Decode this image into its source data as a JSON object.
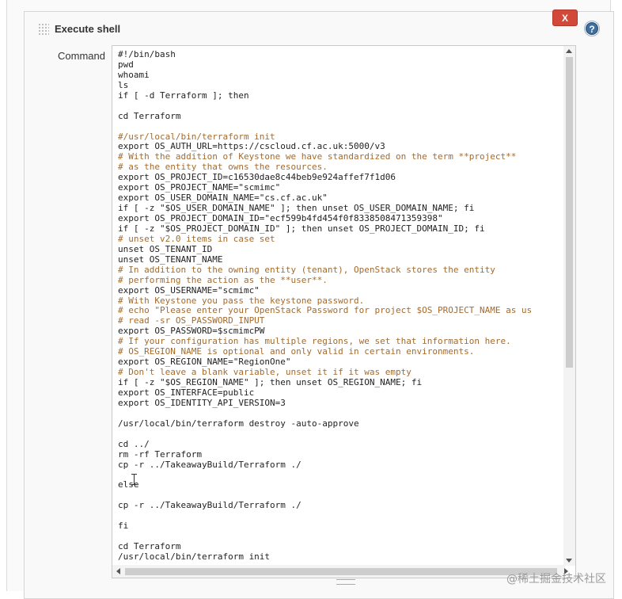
{
  "section": {
    "title": "Execute shell",
    "delete_label": "X",
    "help_label": "?"
  },
  "command": {
    "label": "Command",
    "lines": [
      {
        "text": "#!/bin/bash",
        "comment": false
      },
      {
        "text": "pwd",
        "comment": false
      },
      {
        "text": "whoami",
        "comment": false
      },
      {
        "text": "ls",
        "comment": false
      },
      {
        "text": "if [ -d Terraform ]; then",
        "comment": false
      },
      {
        "text": "",
        "comment": false
      },
      {
        "text": "cd Terraform",
        "comment": false
      },
      {
        "text": "",
        "comment": false
      },
      {
        "text": "#/usr/local/bin/terraform init",
        "comment": true
      },
      {
        "text": "export OS_AUTH_URL=https://cscloud.cf.ac.uk:5000/v3",
        "comment": false
      },
      {
        "text": "# With the addition of Keystone we have standardized on the term **project**",
        "comment": true
      },
      {
        "text": "# as the entity that owns the resources.",
        "comment": true
      },
      {
        "text": "export OS_PROJECT_ID=c16530dae8c44beb9e924affef7f1d06",
        "comment": false
      },
      {
        "text": "export OS_PROJECT_NAME=\"scmimc\"",
        "comment": false
      },
      {
        "text": "export OS_USER_DOMAIN_NAME=\"cs.cf.ac.uk\"",
        "comment": false
      },
      {
        "text": "if [ -z \"$OS_USER_DOMAIN_NAME\" ]; then unset OS_USER_DOMAIN_NAME; fi",
        "comment": false
      },
      {
        "text": "export OS_PROJECT_DOMAIN_ID=\"ecf599b4fd454f0f8338508471359398\"",
        "comment": false
      },
      {
        "text": "if [ -z \"$OS_PROJECT_DOMAIN_ID\" ]; then unset OS_PROJECT_DOMAIN_ID; fi",
        "comment": false
      },
      {
        "text": "# unset v2.0 items in case set",
        "comment": true
      },
      {
        "text": "unset OS_TENANT_ID",
        "comment": false
      },
      {
        "text": "unset OS_TENANT_NAME",
        "comment": false
      },
      {
        "text": "# In addition to the owning entity (tenant), OpenStack stores the entity",
        "comment": true
      },
      {
        "text": "# performing the action as the **user**.",
        "comment": true
      },
      {
        "text": "export OS_USERNAME=\"scmimc\"",
        "comment": false
      },
      {
        "text": "# With Keystone you pass the keystone password.",
        "comment": true
      },
      {
        "text": "# echo \"Please enter your OpenStack Password for project $OS_PROJECT_NAME as us",
        "comment": true
      },
      {
        "text": "# read -sr OS_PASSWORD_INPUT",
        "comment": true
      },
      {
        "text": "export OS_PASSWORD=$scmimcPW",
        "comment": false
      },
      {
        "text": "# If your configuration has multiple regions, we set that information here.",
        "comment": true
      },
      {
        "text": "# OS_REGION_NAME is optional and only valid in certain environments.",
        "comment": true
      },
      {
        "text": "export OS_REGION_NAME=\"RegionOne\"",
        "comment": false
      },
      {
        "text": "# Don't leave a blank variable, unset it if it was empty",
        "comment": true
      },
      {
        "text": "if [ -z \"$OS_REGION_NAME\" ]; then unset OS_REGION_NAME; fi",
        "comment": false
      },
      {
        "text": "export OS_INTERFACE=public",
        "comment": false
      },
      {
        "text": "export OS_IDENTITY_API_VERSION=3",
        "comment": false
      },
      {
        "text": "",
        "comment": false
      },
      {
        "text": "/usr/local/bin/terraform destroy -auto-approve",
        "comment": false
      },
      {
        "text": "",
        "comment": false
      },
      {
        "text": "cd ../",
        "comment": false
      },
      {
        "text": "rm -rf Terraform",
        "comment": false
      },
      {
        "text": "cp -r ../TakeawayBuild/Terraform ./",
        "comment": false
      },
      {
        "text": "",
        "comment": false
      },
      {
        "text": "else",
        "comment": false
      },
      {
        "text": "",
        "comment": false
      },
      {
        "text": "cp -r ../TakeawayBuild/Terraform ./",
        "comment": false
      },
      {
        "text": "",
        "comment": false
      },
      {
        "text": "fi",
        "comment": false
      },
      {
        "text": "",
        "comment": false
      },
      {
        "text": "cd Terraform",
        "comment": false
      },
      {
        "text": "/usr/local/bin/terraform init",
        "comment": false
      }
    ]
  },
  "watermark": "@稀土掘金技术社区"
}
